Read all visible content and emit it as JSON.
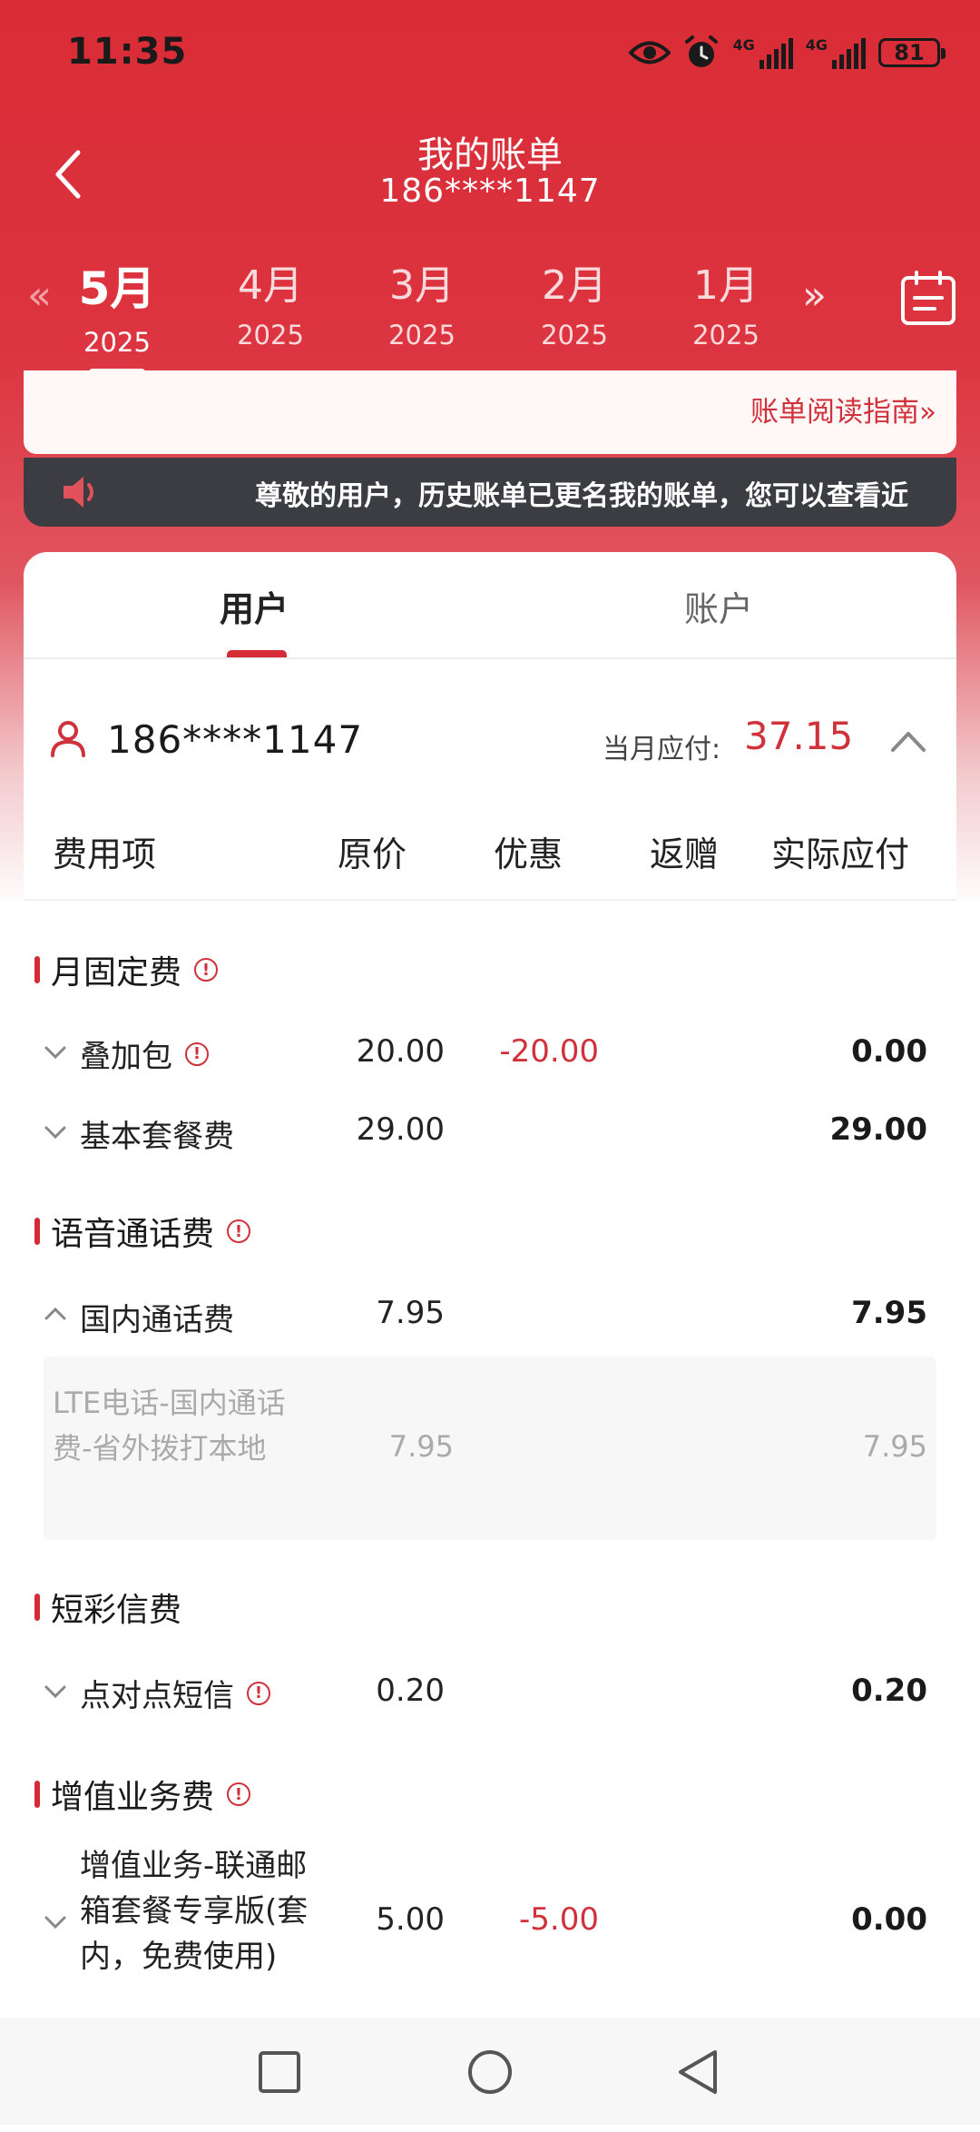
{
  "status_bar": {
    "time": "11:35",
    "net1": "4G",
    "net2": "4G",
    "battery": "81"
  },
  "header": {
    "title": "我的账单",
    "phone": "186****1147"
  },
  "months": [
    {
      "month": "5月",
      "year": "2025",
      "active": true
    },
    {
      "month": "4月",
      "year": "2025"
    },
    {
      "month": "3月",
      "year": "2025"
    },
    {
      "month": "2月",
      "year": "2025"
    },
    {
      "month": "1月",
      "year": "2025"
    }
  ],
  "nav_arrows": {
    "prev": "«",
    "next": "»"
  },
  "guide": {
    "label": "账单阅读指南",
    "suffix": "»"
  },
  "notice": {
    "text": "尊敬的用户，历史账单已更名我的账单，您可以查看近"
  },
  "tabs": {
    "user": "用户",
    "account": "账户"
  },
  "user": {
    "phone": "186****1147",
    "due_label": "当月应付:",
    "due_value": "37.15"
  },
  "columns": {
    "item": "费用项",
    "original": "原价",
    "discount": "优惠",
    "rebate": "返赠",
    "actual": "实际应付"
  },
  "sections": {
    "monthly": "月固定费",
    "voice": "语音通话费",
    "sms": "短彩信费",
    "vas": "增值业务费"
  },
  "rows": {
    "addon": {
      "name": "叠加包",
      "original": "20.00",
      "discount": "-20.00",
      "actual": "0.00"
    },
    "basic": {
      "name": "基本套餐费",
      "original": "29.00",
      "actual": "29.00"
    },
    "domestic": {
      "name": "国内通话费",
      "original": "7.95",
      "actual": "7.95"
    },
    "lte": {
      "name": "LTE电话-国内通话费-省外拨打本地",
      "original": "7.95",
      "actual": "7.95"
    },
    "p2p": {
      "name": "点对点短信",
      "original": "0.20",
      "actual": "0.20"
    },
    "mail": {
      "name": "增值业务-联通邮箱套餐专享版(套内，免费使用)",
      "original": "5.00",
      "discount": "-5.00",
      "actual": "0.00"
    }
  },
  "colors": {
    "brand_red": "#d52b36",
    "discount_red": "#d0323c"
  }
}
